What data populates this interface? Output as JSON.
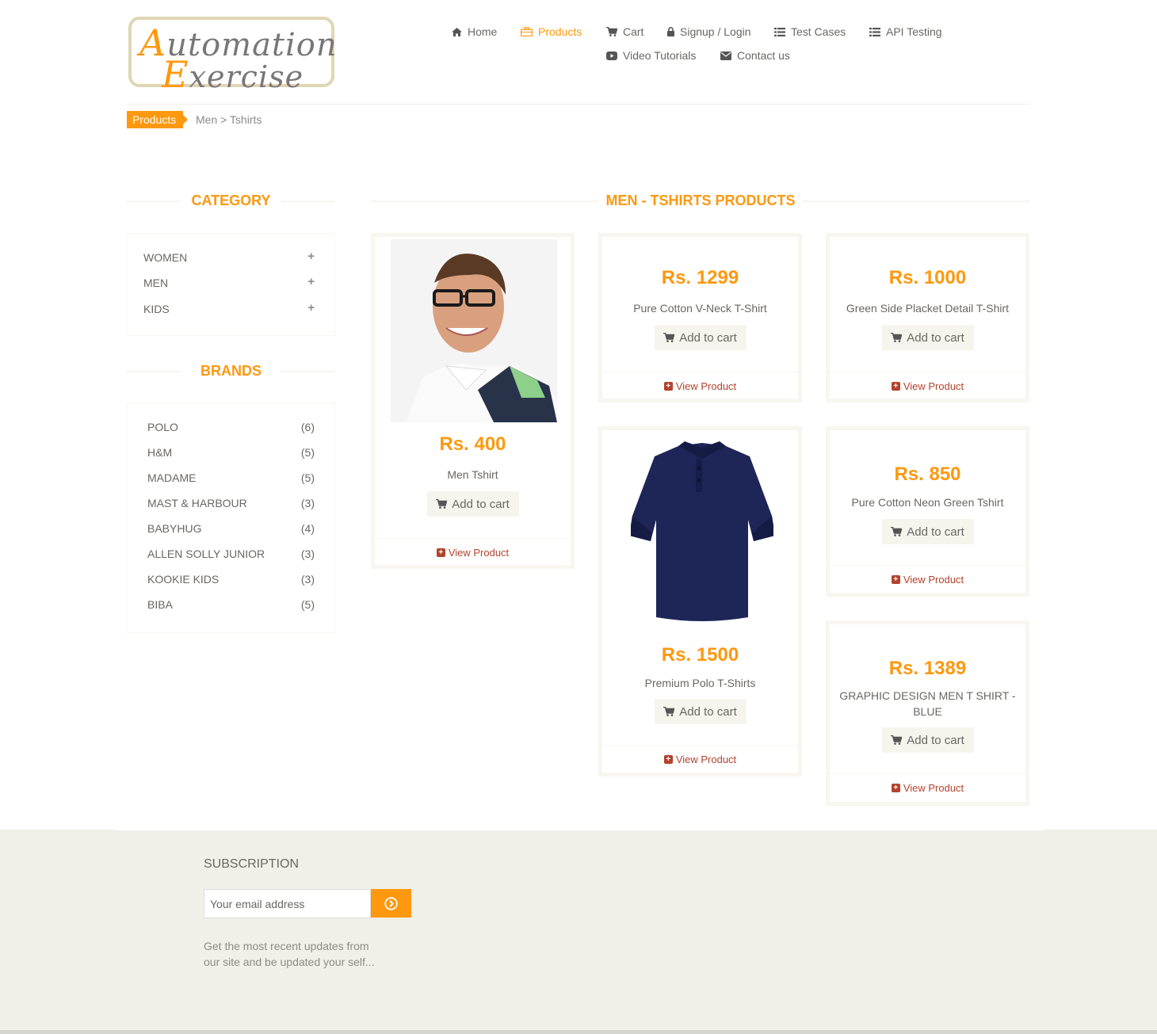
{
  "header": {
    "logo": {
      "line1_cap": "A",
      "line1_rest": "utomation",
      "line2_cap": "E",
      "line2_rest": "xercise"
    },
    "nav": [
      {
        "label": "Home",
        "icon": "home-icon"
      },
      {
        "label": "Products",
        "icon": "briefcase-icon",
        "active": true
      },
      {
        "label": "Cart",
        "icon": "shopping-cart-icon"
      },
      {
        "label": "Signup / Login",
        "icon": "lock-icon"
      },
      {
        "label": "Test Cases",
        "icon": "list-icon"
      },
      {
        "label": "API Testing",
        "icon": "list-icon"
      },
      {
        "label": "Video Tutorials",
        "icon": "youtube-play-icon"
      },
      {
        "label": "Contact us",
        "icon": "envelope-icon"
      }
    ]
  },
  "breadcrumb": {
    "tag": "Products",
    "path": "Men > Tshirts"
  },
  "sidebar": {
    "category_title": "CATEGORY",
    "categories": [
      "WOMEN",
      "MEN",
      "KIDS"
    ],
    "brands_title": "BRANDS",
    "brands": [
      {
        "name": "POLO",
        "count": "(6)"
      },
      {
        "name": "H&M",
        "count": "(5)"
      },
      {
        "name": "MADAME",
        "count": "(5)"
      },
      {
        "name": "MAST & HARBOUR",
        "count": "(3)"
      },
      {
        "name": "BABYHUG",
        "count": "(4)"
      },
      {
        "name": "ALLEN SOLLY JUNIOR",
        "count": "(3)"
      },
      {
        "name": "KOOKIE KIDS",
        "count": "(3)"
      },
      {
        "name": "BIBA",
        "count": "(5)"
      }
    ]
  },
  "products_title": "MEN - TSHIRTS PRODUCTS",
  "products": [
    {
      "price": "Rs. 400",
      "name": "Men Tshirt",
      "add_label": "Add to cart",
      "view_label": "View Product"
    },
    {
      "price": "Rs. 1299",
      "name": "Pure Cotton V-Neck T-Shirt",
      "add_label": "Add to cart",
      "view_label": "View Product"
    },
    {
      "price": "Rs. 1000",
      "name": "Green Side Placket Detail T-Shirt",
      "add_label": "Add to cart",
      "view_label": "View Product"
    },
    {
      "price": "Rs. 1500",
      "name": "Premium Polo T-Shirts",
      "add_label": "Add to cart",
      "view_label": "View Product"
    },
    {
      "price": "Rs. 850",
      "name": "Pure Cotton Neon Green Tshirt",
      "add_label": "Add to cart",
      "view_label": "View Product"
    },
    {
      "price": "Rs. 1389",
      "name": "GRAPHIC DESIGN MEN T SHIRT - BLUE",
      "add_label": "Add to cart",
      "view_label": "View Product"
    }
  ],
  "footer": {
    "subscription_title": "SUBSCRIPTION",
    "email_placeholder": "Your email address",
    "note": "Get the most recent updates from our site and be updated your self..."
  },
  "colors": {
    "accent": "#FE980F",
    "view_link": "#B3432D",
    "footer_bg": "#F0F0E9"
  }
}
